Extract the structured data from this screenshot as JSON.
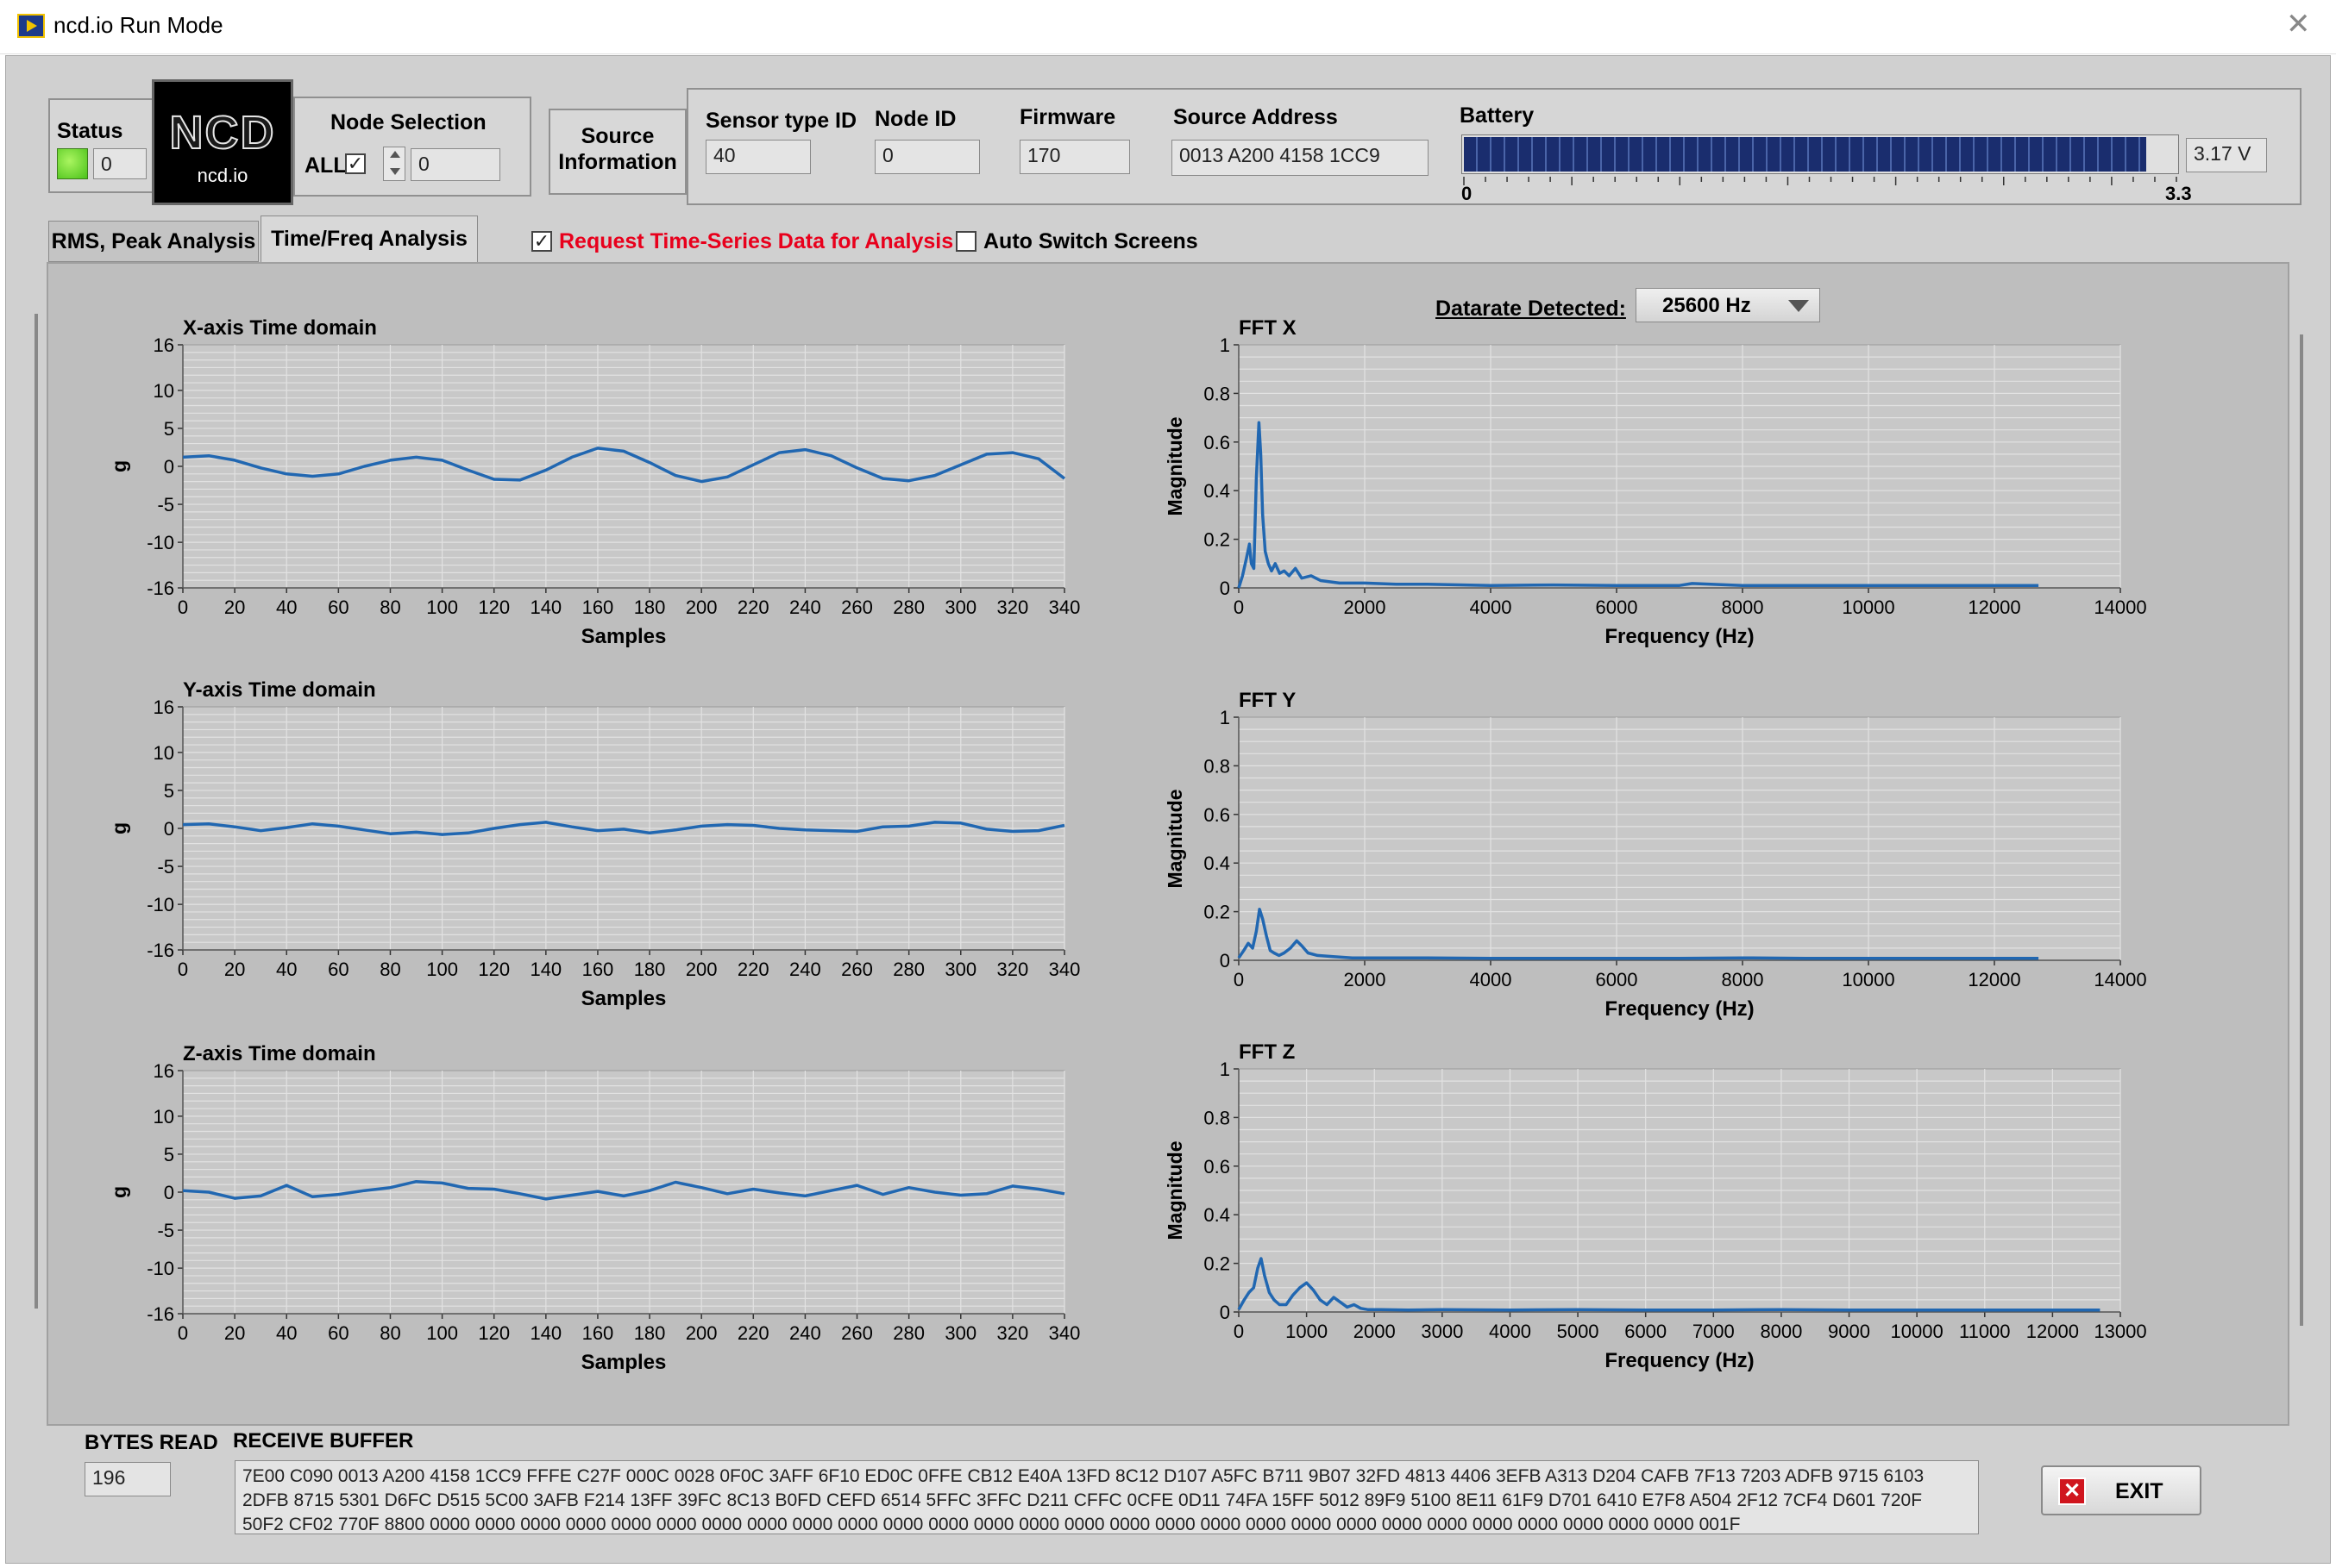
{
  "window": {
    "title": "ncd.io Run Mode",
    "close_glyph": "✕"
  },
  "logo": {
    "main": "NCD",
    "sub": "ncd.io"
  },
  "status": {
    "label": "Status",
    "value": "0"
  },
  "node_selection": {
    "label": "Node Selection",
    "all_label": "ALL",
    "all_checked": true,
    "value": "0"
  },
  "source_info_button": {
    "line1": "Source",
    "line2": "Information"
  },
  "sensor_type": {
    "label": "Sensor type ID",
    "value": "40"
  },
  "node_id": {
    "label": "Node ID",
    "value": "0"
  },
  "firmware": {
    "label": "Firmware",
    "value": "170"
  },
  "source_address": {
    "label": "Source Address",
    "value": "0013 A200 4158 1CC9"
  },
  "battery": {
    "label": "Battery",
    "value": "3.17",
    "unit": "V",
    "scale_min": "0",
    "scale_max": "3.3",
    "level": 3.17,
    "max": 3.3,
    "fill_color": "#1a2d6e"
  },
  "tabs": [
    {
      "label": "RMS, Peak Analysis",
      "active": false
    },
    {
      "label": "Time/Freq Analysis",
      "active": true
    }
  ],
  "options": {
    "request_label": "Request Time-Series Data for Analysis",
    "request_checked": true,
    "auto_switch_label": "Auto Switch Screens",
    "auto_switch_checked": false
  },
  "datarate": {
    "label": "Datarate Detected:",
    "value": "25600 Hz"
  },
  "chart_data": [
    {
      "id": "time_x",
      "type": "line",
      "title": "X-axis Time domain",
      "xlabel": "Samples",
      "ylabel": "g",
      "xlim": [
        0,
        340
      ],
      "ylim": [
        -16,
        16
      ],
      "xticks": [
        0,
        20,
        40,
        60,
        80,
        100,
        120,
        140,
        160,
        180,
        200,
        220,
        240,
        260,
        280,
        300,
        320,
        340
      ],
      "yticks": [
        16,
        10,
        5,
        0,
        -5,
        -10,
        -16
      ],
      "x": [
        0,
        10,
        20,
        30,
        40,
        50,
        60,
        70,
        80,
        90,
        100,
        110,
        120,
        130,
        140,
        150,
        160,
        170,
        180,
        190,
        200,
        210,
        220,
        230,
        240,
        250,
        260,
        270,
        280,
        290,
        300,
        310,
        320,
        330,
        340
      ],
      "y": [
        1.2,
        1.4,
        0.8,
        -0.2,
        -1.0,
        -1.3,
        -1.0,
        0.0,
        0.8,
        1.2,
        0.8,
        -0.5,
        -1.7,
        -1.8,
        -0.5,
        1.2,
        2.4,
        2.0,
        0.5,
        -1.2,
        -2.0,
        -1.4,
        0.2,
        1.8,
        2.2,
        1.4,
        -0.2,
        -1.6,
        -1.9,
        -1.2,
        0.2,
        1.6,
        1.8,
        1.0,
        -1.6
      ]
    },
    {
      "id": "time_y",
      "type": "line",
      "title": "Y-axis Time domain",
      "xlabel": "Samples",
      "ylabel": "g",
      "xlim": [
        0,
        340
      ],
      "ylim": [
        -16,
        16
      ],
      "xticks": [
        0,
        20,
        40,
        60,
        80,
        100,
        120,
        140,
        160,
        180,
        200,
        220,
        240,
        260,
        280,
        300,
        320,
        340
      ],
      "yticks": [
        16,
        10,
        5,
        0,
        -5,
        -10,
        -16
      ],
      "x": [
        0,
        10,
        20,
        30,
        40,
        50,
        60,
        70,
        80,
        90,
        100,
        110,
        120,
        130,
        140,
        150,
        160,
        170,
        180,
        190,
        200,
        210,
        220,
        230,
        240,
        250,
        260,
        270,
        280,
        290,
        300,
        310,
        320,
        330,
        340
      ],
      "y": [
        0.5,
        0.6,
        0.2,
        -0.3,
        0.1,
        0.6,
        0.3,
        -0.2,
        -0.7,
        -0.5,
        -0.8,
        -0.6,
        0.0,
        0.5,
        0.8,
        0.2,
        -0.3,
        -0.1,
        -0.6,
        -0.2,
        0.3,
        0.5,
        0.4,
        0.0,
        -0.2,
        -0.3,
        -0.4,
        0.2,
        0.3,
        0.8,
        0.7,
        -0.1,
        -0.4,
        -0.3,
        0.4
      ]
    },
    {
      "id": "time_z",
      "type": "line",
      "title": "Z-axis Time domain",
      "xlabel": "Samples",
      "ylabel": "g",
      "xlim": [
        0,
        340
      ],
      "ylim": [
        -16,
        16
      ],
      "xticks": [
        0,
        20,
        40,
        60,
        80,
        100,
        120,
        140,
        160,
        180,
        200,
        220,
        240,
        260,
        280,
        300,
        320,
        340
      ],
      "yticks": [
        16,
        10,
        5,
        0,
        -5,
        -10,
        -16
      ],
      "x": [
        0,
        10,
        20,
        30,
        40,
        50,
        60,
        70,
        80,
        90,
        100,
        110,
        120,
        130,
        140,
        150,
        160,
        170,
        180,
        190,
        200,
        210,
        220,
        230,
        240,
        250,
        260,
        270,
        280,
        290,
        300,
        310,
        320,
        330,
        340
      ],
      "y": [
        0.2,
        0.0,
        -0.8,
        -0.5,
        0.9,
        -0.6,
        -0.3,
        0.2,
        0.6,
        1.4,
        1.2,
        0.5,
        0.4,
        -0.2,
        -0.9,
        -0.4,
        0.1,
        -0.5,
        0.2,
        1.3,
        0.6,
        -0.2,
        0.4,
        -0.1,
        -0.5,
        0.2,
        0.9,
        -0.3,
        0.6,
        0.0,
        -0.4,
        -0.2,
        0.8,
        0.4,
        -0.2
      ]
    },
    {
      "id": "fft_x",
      "type": "line",
      "title": "FFT X",
      "xlabel": "Frequency (Hz)",
      "ylabel": "Magnitude",
      "xlim": [
        0,
        14000
      ],
      "ylim": [
        0,
        1
      ],
      "xticks": [
        0,
        2000,
        4000,
        6000,
        8000,
        10000,
        12000,
        14000
      ],
      "yticks": [
        1,
        0.8,
        0.6,
        0.4,
        0.2,
        0
      ],
      "x": [
        0,
        60,
        120,
        170,
        200,
        240,
        280,
        320,
        350,
        380,
        420,
        470,
        520,
        580,
        650,
        720,
        800,
        900,
        1000,
        1150,
        1300,
        1600,
        2000,
        2500,
        3000,
        4000,
        5000,
        6000,
        7000,
        7200,
        8000,
        9000,
        10000,
        11000,
        12000,
        12700
      ],
      "y": [
        0,
        0.05,
        0.12,
        0.18,
        0.1,
        0.08,
        0.45,
        0.68,
        0.55,
        0.3,
        0.15,
        0.1,
        0.07,
        0.1,
        0.06,
        0.07,
        0.05,
        0.08,
        0.04,
        0.05,
        0.03,
        0.02,
        0.02,
        0.015,
        0.015,
        0.01,
        0.012,
        0.01,
        0.01,
        0.018,
        0.01,
        0.01,
        0.01,
        0.01,
        0.01,
        0.01
      ]
    },
    {
      "id": "fft_y",
      "type": "line",
      "title": "FFT Y",
      "xlabel": "Frequency (Hz)",
      "ylabel": "Magnitude",
      "xlim": [
        0,
        14000
      ],
      "ylim": [
        0,
        1
      ],
      "xticks": [
        0,
        2000,
        4000,
        6000,
        8000,
        10000,
        12000,
        14000
      ],
      "yticks": [
        1,
        0.8,
        0.6,
        0.4,
        0.2,
        0
      ],
      "x": [
        0,
        80,
        150,
        220,
        280,
        330,
        380,
        440,
        500,
        560,
        640,
        720,
        820,
        920,
        1000,
        1100,
        1250,
        1500,
        1800,
        2200,
        3000,
        4000,
        5000,
        6000,
        7000,
        8000,
        9000,
        10000,
        11000,
        12000,
        12700
      ],
      "y": [
        0.01,
        0.04,
        0.07,
        0.05,
        0.12,
        0.21,
        0.17,
        0.1,
        0.04,
        0.03,
        0.02,
        0.03,
        0.05,
        0.08,
        0.06,
        0.03,
        0.02,
        0.015,
        0.01,
        0.01,
        0.01,
        0.008,
        0.008,
        0.008,
        0.008,
        0.01,
        0.008,
        0.008,
        0.008,
        0.008,
        0.008
      ]
    },
    {
      "id": "fft_z",
      "type": "line",
      "title": "FFT Z",
      "xlabel": "Frequency (Hz)",
      "ylabel": "Magnitude",
      "xlim": [
        0,
        13000
      ],
      "ylim": [
        0,
        1
      ],
      "xticks": [
        0,
        1000,
        2000,
        3000,
        4000,
        5000,
        6000,
        7000,
        8000,
        9000,
        10000,
        11000,
        12000,
        13000
      ],
      "yticks": [
        1,
        0.8,
        0.6,
        0.4,
        0.2,
        0
      ],
      "x": [
        0,
        80,
        150,
        220,
        280,
        330,
        380,
        450,
        520,
        600,
        700,
        800,
        900,
        1000,
        1100,
        1200,
        1300,
        1400,
        1500,
        1600,
        1700,
        1800,
        1900,
        2100,
        2500,
        3000,
        4000,
        5000,
        6000,
        7000,
        8000,
        9000,
        10000,
        11000,
        12000,
        12700
      ],
      "y": [
        0.01,
        0.05,
        0.08,
        0.1,
        0.18,
        0.22,
        0.15,
        0.08,
        0.05,
        0.03,
        0.03,
        0.07,
        0.1,
        0.12,
        0.09,
        0.05,
        0.03,
        0.06,
        0.04,
        0.02,
        0.03,
        0.015,
        0.01,
        0.01,
        0.008,
        0.01,
        0.008,
        0.01,
        0.008,
        0.008,
        0.01,
        0.008,
        0.008,
        0.008,
        0.008,
        0.008
      ]
    }
  ],
  "bytes_read": {
    "label": "BYTES READ",
    "value": "196"
  },
  "receive_buffer": {
    "label": "RECEIVE BUFFER",
    "lines": [
      "7E00 C090 0013 A200 4158 1CC9 FFFE C27F 000C 0028 0F0C 3AFF 6F10 ED0C 0FFE CB12 E40A 13FD 8C12 D107 A5FC B711 9B07 32FD 4813 4406 3EFB A313 D204 CAFB 7F13 7203 ADFB 9715 6103",
      "2DFB 8715 5301 D6FC D515 5C00 3AFB F214 13FF 39FC 8C13 B0FD CEFD 6514 5FFC 3FFC D211 CFFC 0CFE 0D11 74FA 15FF 5012 89F9 5100 8E11 61F9 D701 6410 E7F8 A504 2F12 7CF4 D601 720F",
      "50F2 CF02 770F 8800 0000 0000 0000 0000 0000 0000 0000 0000 0000 0000 0000 0000 0000 0000 0000 0000 0000 0000 0000 0000 0000 0000 0000 0000 0000 0000 0000 0000 001F"
    ]
  },
  "exit_button": {
    "label": "EXIT",
    "icon_glyph": "✕"
  },
  "colors": {
    "trace": "#2167b1",
    "plot_bg": "#c8c8c8",
    "grid": "#e2e2e2",
    "request_text": "#e8001c"
  }
}
